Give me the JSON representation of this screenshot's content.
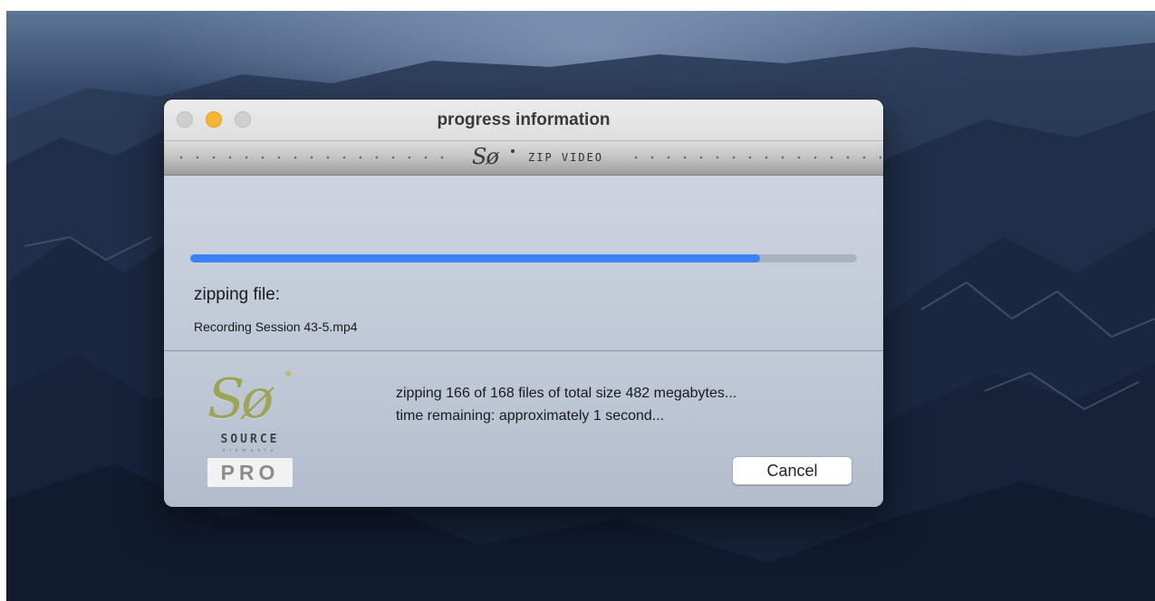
{
  "window": {
    "title": "progress information"
  },
  "banner": {
    "logo_text": "Sø",
    "app_name": "ZIP VIDEO"
  },
  "progress": {
    "fraction": 0.855,
    "status_label": "zipping file:",
    "current_file": "Recording Session 43-5.mp4"
  },
  "summary": {
    "line1": "zipping 166 of 168 files of total size 482 megabytes...",
    "line2": "time remaining: approximately 1 second..."
  },
  "logo": {
    "mark": "Sø",
    "brand": "SOURCE",
    "subbrand": "elements",
    "edition": "PRO"
  },
  "buttons": {
    "cancel_label": "Cancel"
  },
  "colors": {
    "progress_accent": "#3c82f6",
    "minimize_light": "#f5b731",
    "inactive_light": "#cfcfcf"
  }
}
